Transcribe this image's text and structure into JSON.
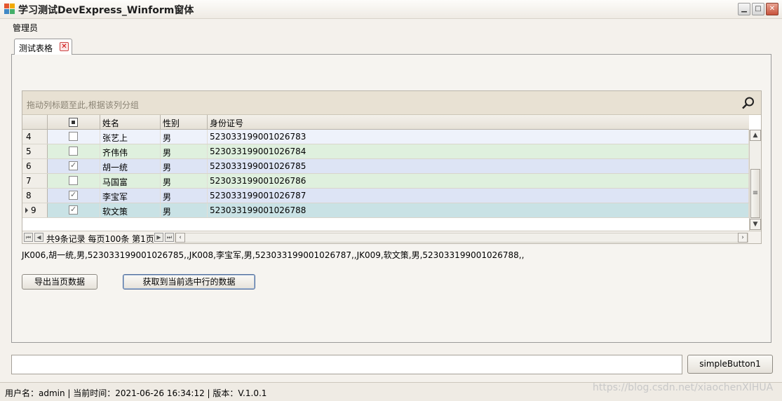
{
  "window": {
    "title": "学习测试DevExpress_Winform窗体"
  },
  "menu": {
    "items": [
      "管理员"
    ]
  },
  "tab": {
    "label": "测试表格"
  },
  "grid": {
    "group_panel_text": "拖动列标题至此,根据该列分组",
    "columns": [
      "姓名",
      "性别",
      "身份证号"
    ],
    "rows": [
      {
        "index": "4",
        "checked": false,
        "name": "张艺上",
        "gender": "男",
        "id": "523033199001026783",
        "bg": "#eef2fb"
      },
      {
        "index": "5",
        "checked": false,
        "name": "齐伟伟",
        "gender": "男",
        "id": "523033199001026784",
        "bg": "#dff0de"
      },
      {
        "index": "6",
        "checked": true,
        "name": "胡一统",
        "gender": "男",
        "id": "523033199001026785",
        "bg": "#dde4f5"
      },
      {
        "index": "7",
        "checked": false,
        "name": "马国富",
        "gender": "男",
        "id": "523033199001026786",
        "bg": "#dff0de"
      },
      {
        "index": "8",
        "checked": true,
        "name": "李宝军",
        "gender": "男",
        "id": "523033199001026787",
        "bg": "#dde4f5"
      },
      {
        "index": "9",
        "checked": true,
        "name": "软文策",
        "gender": "男",
        "id": "523033199001026788",
        "bg": "#c9e2e5"
      }
    ],
    "navigator_text": "共9条记录 每页100条 第1页"
  },
  "selection_text": "JK006,胡一统,男,523033199001026785,,JK008,李宝军,男,523033199001026787,,JK009,软文策,男,523033199001026788,,",
  "buttons": {
    "export": "导出当页数据",
    "get_selected": "获取到当前选中行的数据",
    "simple": "simpleButton1"
  },
  "input": {
    "value": ""
  },
  "status": {
    "text": "用户名：admin  |   当前时间：2021-06-26 16:34:12   |   版本：V.1.0.1"
  },
  "watermark": "https://blog.csdn.net/xiaochenXIHUA",
  "colors": {
    "accent": "#506d9b",
    "group_panel": "#e8e1d3"
  }
}
